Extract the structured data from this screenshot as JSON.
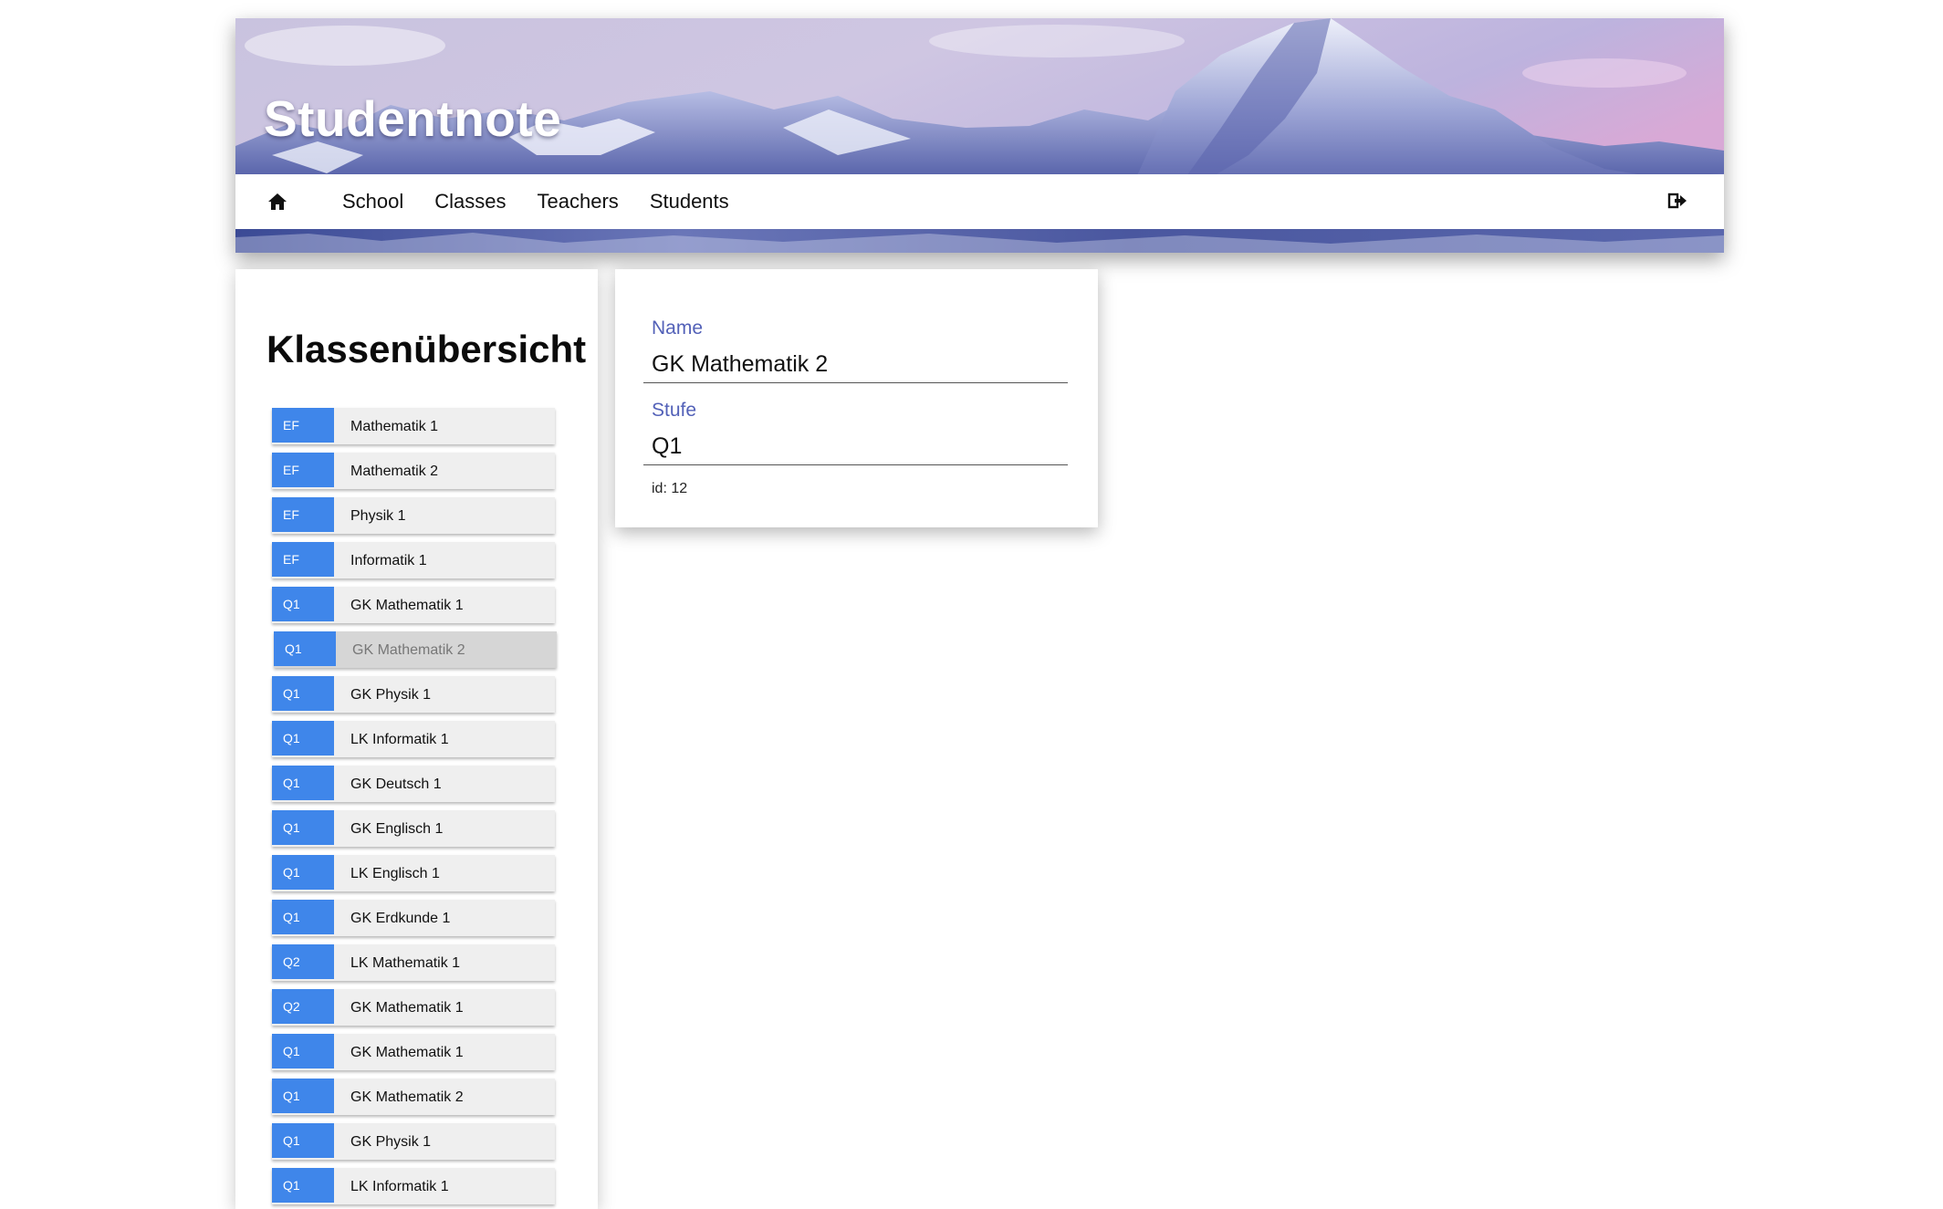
{
  "header": {
    "title": "Studentnote"
  },
  "nav": {
    "home_icon": "home-icon",
    "links": [
      "School",
      "Classes",
      "Teachers",
      "Students"
    ],
    "logout_icon": "logout-icon"
  },
  "sidebar": {
    "title": "Klassenübersicht",
    "classes": [
      {
        "level": "EF",
        "name": "Mathematik 1"
      },
      {
        "level": "EF",
        "name": "Mathematik 2"
      },
      {
        "level": "EF",
        "name": "Physik 1"
      },
      {
        "level": "EF",
        "name": "Informatik 1"
      },
      {
        "level": "Q1",
        "name": "GK Mathematik 1"
      },
      {
        "level": "Q1",
        "name": "GK Mathematik 2",
        "selected": true
      },
      {
        "level": "Q1",
        "name": "GK Physik 1"
      },
      {
        "level": "Q1",
        "name": "LK Informatik 1"
      },
      {
        "level": "Q1",
        "name": "GK Deutsch 1"
      },
      {
        "level": "Q1",
        "name": "GK Englisch 1"
      },
      {
        "level": "Q1",
        "name": "LK Englisch 1"
      },
      {
        "level": "Q1",
        "name": "GK Erdkunde 1"
      },
      {
        "level": "Q2",
        "name": "LK Mathematik 1"
      },
      {
        "level": "Q2",
        "name": "GK Mathematik 1"
      },
      {
        "level": "Q1",
        "name": "GK Mathematik 1"
      },
      {
        "level": "Q1",
        "name": "GK Mathematik 2"
      },
      {
        "level": "Q1",
        "name": "GK Physik 1"
      },
      {
        "level": "Q1",
        "name": "LK Informatik 1"
      }
    ]
  },
  "detail": {
    "name_label": "Name",
    "name_value": "GK Mathematik 2",
    "level_label": "Stufe",
    "level_value": "Q1",
    "id_text": "id: 12"
  },
  "colors": {
    "level_badge": "#3f86ea",
    "field_label": "#5361b8",
    "selected_item": "#d6d6d6"
  }
}
